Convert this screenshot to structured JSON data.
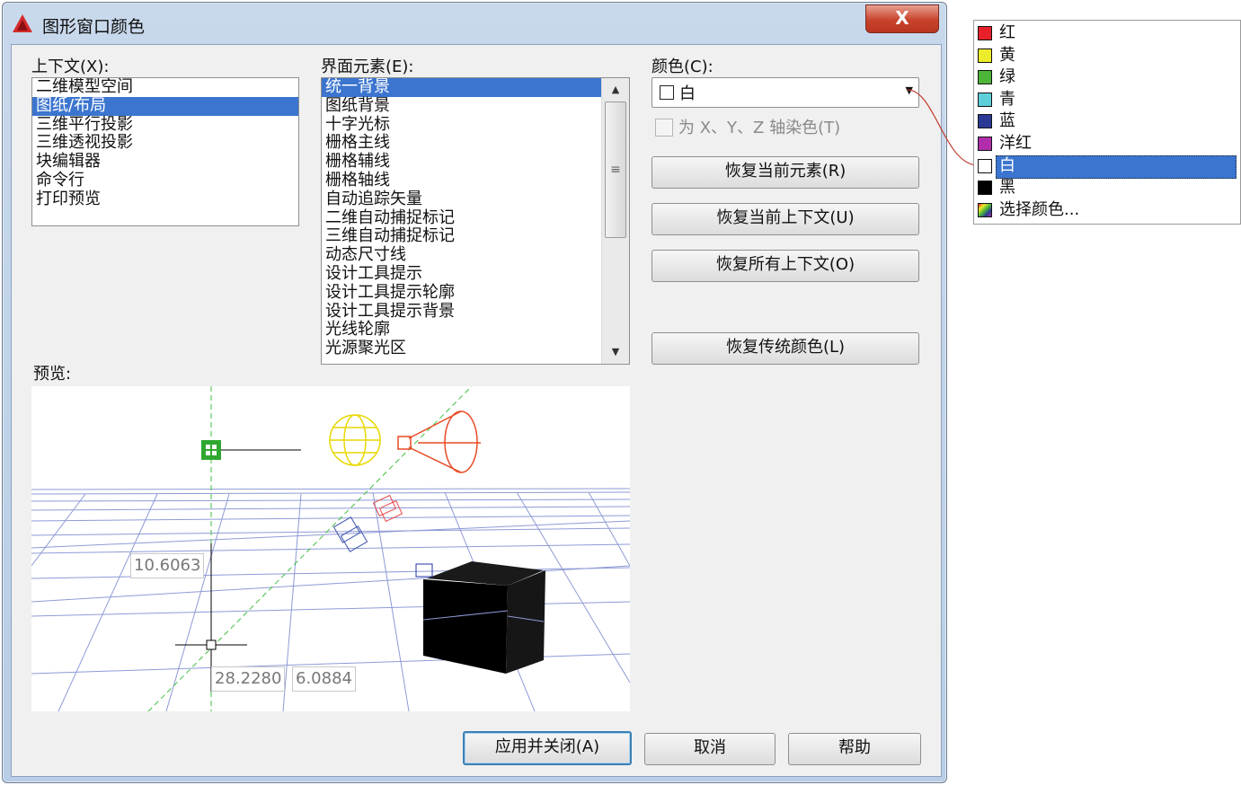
{
  "window": {
    "title": "图形窗口颜色",
    "close_label": "X"
  },
  "context": {
    "label": "上下文(X):",
    "items": [
      "二维模型空间",
      "图纸/布局",
      "三维平行投影",
      "三维透视投影",
      "块编辑器",
      "命令行",
      "打印预览"
    ],
    "selected_index": 1
  },
  "interface": {
    "label": "界面元素(E):",
    "items": [
      "统一背景",
      "图纸背景",
      "十字光标",
      "栅格主线",
      "栅格辅线",
      "栅格轴线",
      "自动追踪矢量",
      "二维自动捕捉标记",
      "三维自动捕捉标记",
      "动态尺寸线",
      "设计工具提示",
      "设计工具提示轮廓",
      "设计工具提示背景",
      "光线轮廓",
      "光源聚光区"
    ],
    "selected_index": 0
  },
  "color": {
    "label": "颜色(C):",
    "value": "白",
    "swatch": "#ffffff",
    "tint_checkbox_label": "为 X、Y、Z 轴染色(T)",
    "tint_checked": false
  },
  "buttons": {
    "restore_element": "恢复当前元素(R)",
    "restore_context": "恢复当前上下文(U)",
    "restore_all": "恢复所有上下文(O)",
    "restore_classic": "恢复传统颜色(L)",
    "apply_close": "应用并关闭(A)",
    "cancel": "取消",
    "help": "帮助"
  },
  "preview": {
    "label": "预览:",
    "coord_left": "10.6063",
    "coord_x": "28.2280",
    "coord_y": "6.0884"
  },
  "color_dropdown": {
    "items": [
      {
        "label": "红",
        "color": "#e8202a"
      },
      {
        "label": "黄",
        "color": "#ecec2a"
      },
      {
        "label": "绿",
        "color": "#4cb53a"
      },
      {
        "label": "青",
        "color": "#5ccfd8"
      },
      {
        "label": "蓝",
        "color": "#2a3a94"
      },
      {
        "label": "洋红",
        "color": "#b02eac"
      },
      {
        "label": "白",
        "color": "#ffffff"
      },
      {
        "label": "黑",
        "color": "#000000"
      },
      {
        "label": "选择颜色...",
        "color": "multicolor"
      }
    ],
    "selected_index": 6
  },
  "colors": {
    "selection": "#3b75cf",
    "accent_red": "#c8432b"
  }
}
